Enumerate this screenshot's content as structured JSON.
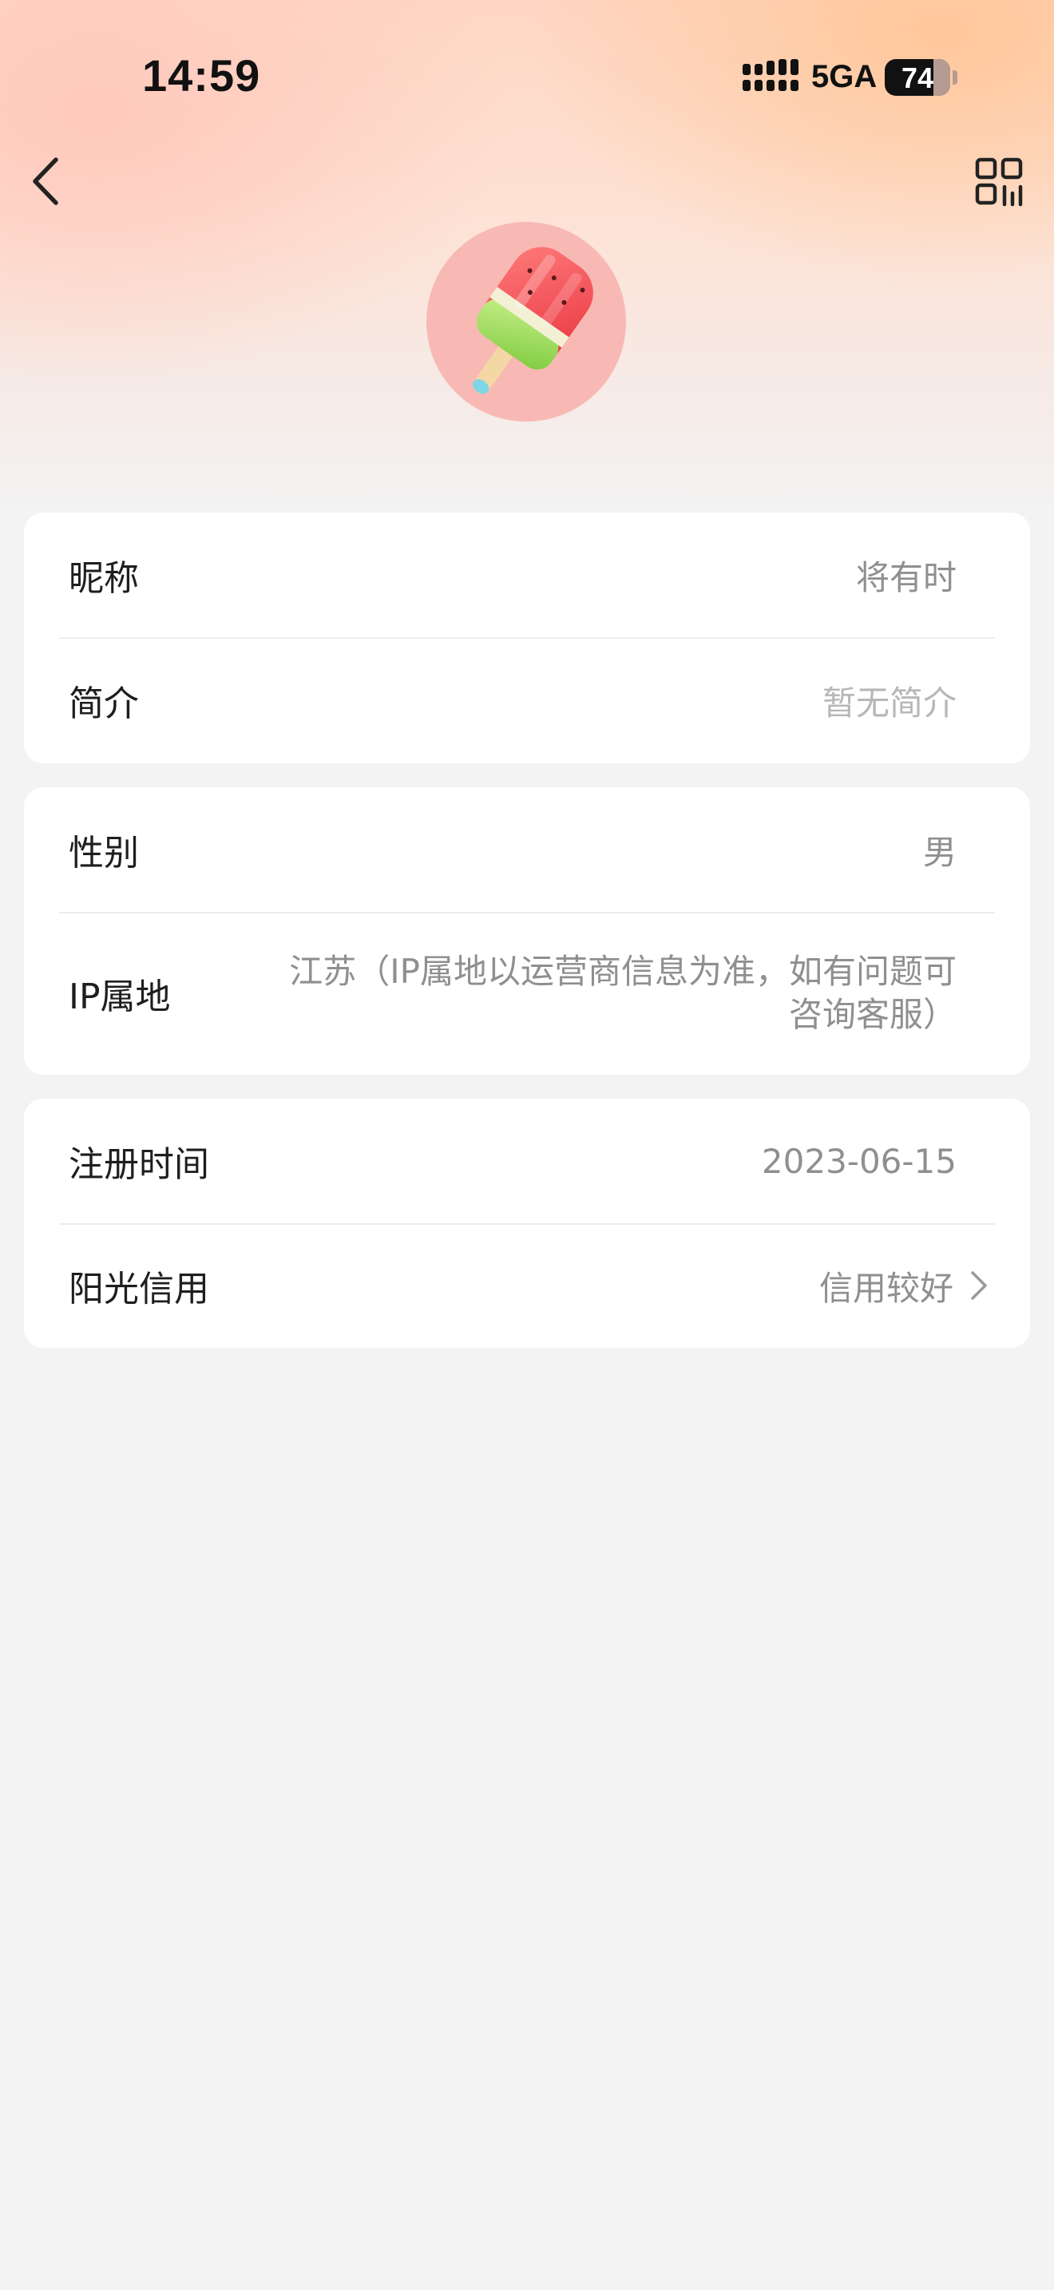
{
  "status_bar": {
    "time": "14:59",
    "network": "5GA",
    "battery": "74",
    "battery_level": 0.74
  },
  "nav": {
    "back_icon": "chevron-left-icon",
    "qr_icon": "qr-code-icon"
  },
  "avatar": {
    "description_icon": "popsicle-avatar",
    "bg_color": "#f8b9b4"
  },
  "sections": {
    "basic": {
      "nickname_label": "昵称",
      "nickname_value": "将有时",
      "bio_label": "简介",
      "bio_value": "暂无简介"
    },
    "personal": {
      "gender_label": "性别",
      "gender_value": "男",
      "ip_label": "IP属地",
      "ip_value": "江苏（IP属地以运营商信息为准，如有问题可咨询客服）"
    },
    "account": {
      "register_label": "注册时间",
      "register_value": "2023-06-15",
      "credit_label": "阳光信用",
      "credit_value": "信用较好"
    }
  },
  "colors": {
    "page_bg": "#f3f3f3",
    "card_bg": "#ffffff",
    "label_text": "#1e1e1e",
    "value_text": "#8f8f8f"
  }
}
